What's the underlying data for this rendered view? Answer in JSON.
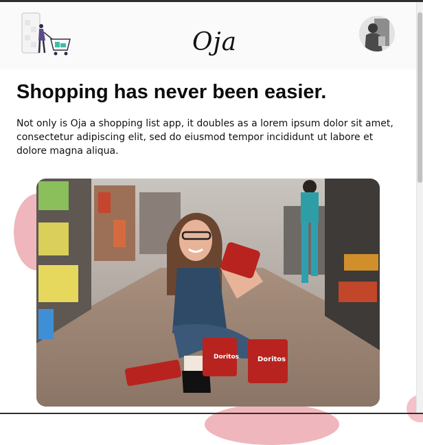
{
  "header": {
    "brand": "Oja",
    "logo_icon": "shopping-cart-illustration-icon",
    "avatar_icon": "user-avatar-icon"
  },
  "hero": {
    "title": "Shopping has never been easier.",
    "description": "Not only is Oja a shopping list app, it doubles as a lorem ipsum dolor sit amet, consectetur adipiscing elit, sed do eiusmod tempor incididunt ut labore et dolore magna aliqua.",
    "image_alt_icon": "shopper-photo",
    "snack_label": "Doritos"
  },
  "colors": {
    "accent_blob": "#f0b6bd",
    "header_bg": "#fafafa",
    "text": "#111111"
  }
}
